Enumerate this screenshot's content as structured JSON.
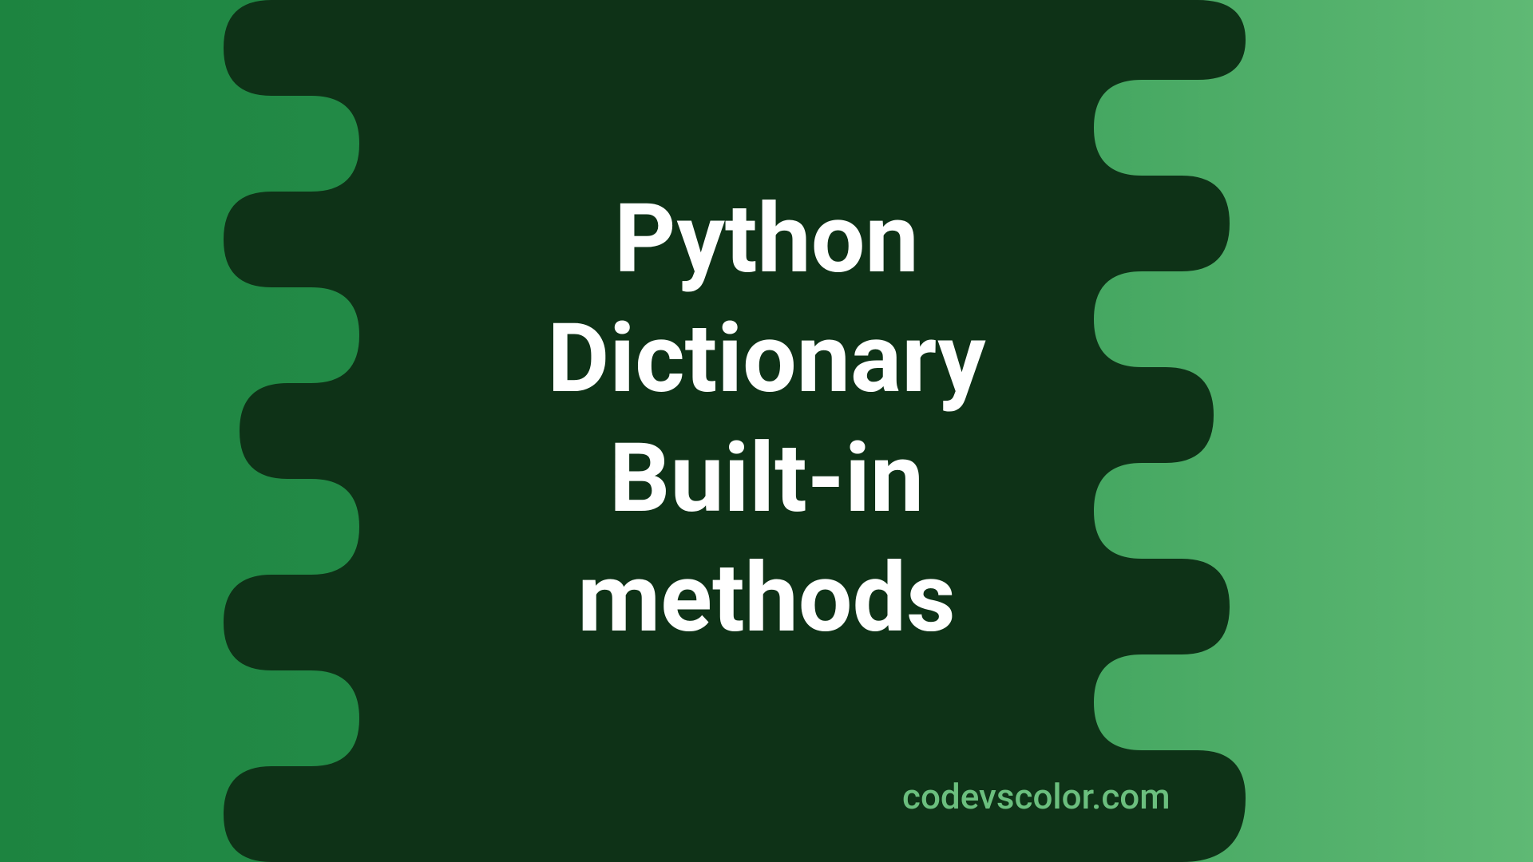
{
  "title": "Python\nDictionary\nBuilt-in\nmethods",
  "watermark": "codevscolor.com",
  "colors": {
    "blob": "#0e3217",
    "title_text": "#ffffff",
    "watermark_text": "#6bbf7e"
  }
}
